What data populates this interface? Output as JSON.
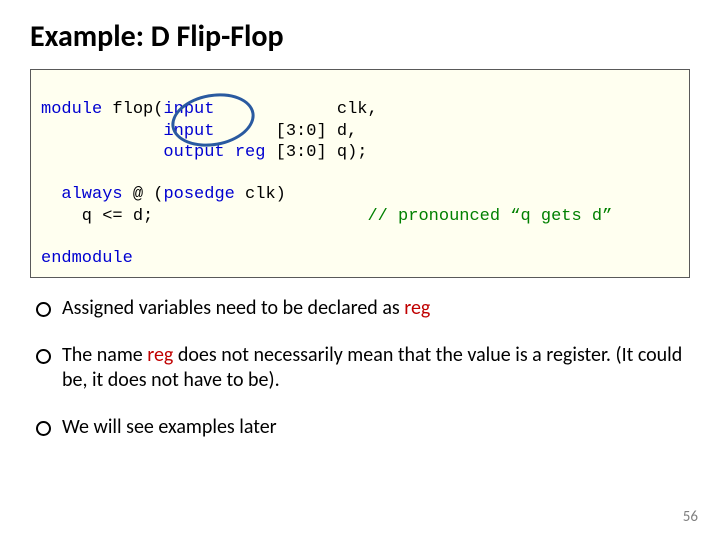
{
  "title": "Example: D Flip-Flop",
  "code": {
    "kw_module": "module",
    "line1a": " flop(",
    "kw_input1": "input",
    "line1b": "            clk,",
    "line2a": "            ",
    "kw_input2": "input",
    "line2b": "      [3:0] d,",
    "line3a": "            ",
    "kw_output": "output",
    "kw_reg": "reg",
    "line3b": " [3:0] q);",
    "blank1": " ",
    "line4a": "  ",
    "kw_always": "always",
    "line4b": " @ (",
    "kw_posedge": "posedge",
    "line4c": " clk)",
    "line5a": "    q <= d;                     ",
    "comment": "// pronounced “q gets d”",
    "blank2": " ",
    "kw_endmodule": "endmodule"
  },
  "bullets": {
    "b1a": "Assigned variables need to be declared as ",
    "b1_reg": "reg",
    "b2a": "The name ",
    "b2_reg": "reg",
    "b2b": " does not necessarily mean that the value is a register. (It could be, it does not have to be).",
    "b3": "We will see examples later"
  },
  "pagenum": "56"
}
